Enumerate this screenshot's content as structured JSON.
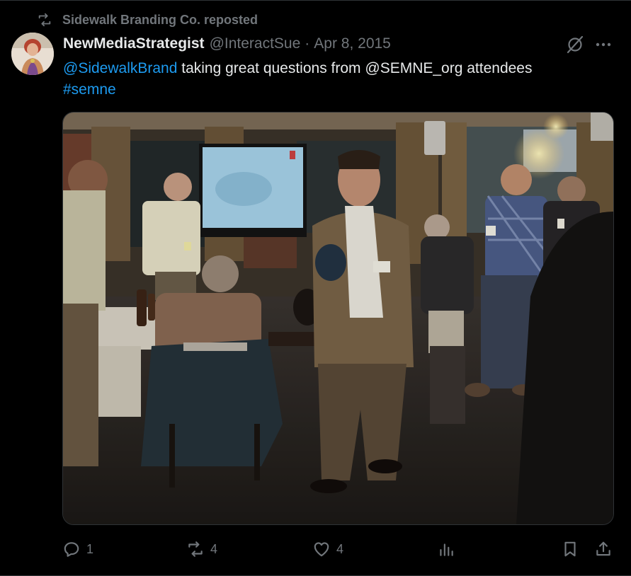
{
  "repost": {
    "text": "Sidewalk Branding Co. reposted"
  },
  "tweet": {
    "display_name": "NewMediaStrategist",
    "handle": "@InteractSue",
    "separator": "·",
    "date": "Apr 8, 2015",
    "mention": "@SidewalkBrand",
    "body": " taking great questions from @SEMNE_org attendees",
    "hashtag": "#semne"
  },
  "actions": {
    "replies": "1",
    "reposts": "4",
    "likes": "4"
  },
  "icons": {
    "repost_header": "repost-icon",
    "grok": "grok-icon",
    "more": "more-icon",
    "reply": "reply-icon",
    "repost": "repost-icon",
    "like": "heart-icon",
    "views": "views-icon",
    "bookmark": "bookmark-icon",
    "share": "share-icon"
  },
  "colors": {
    "background": "#000000",
    "text": "#e7e9ea",
    "muted": "#71767b",
    "link": "#1d9bf0",
    "border": "#2f3336"
  }
}
